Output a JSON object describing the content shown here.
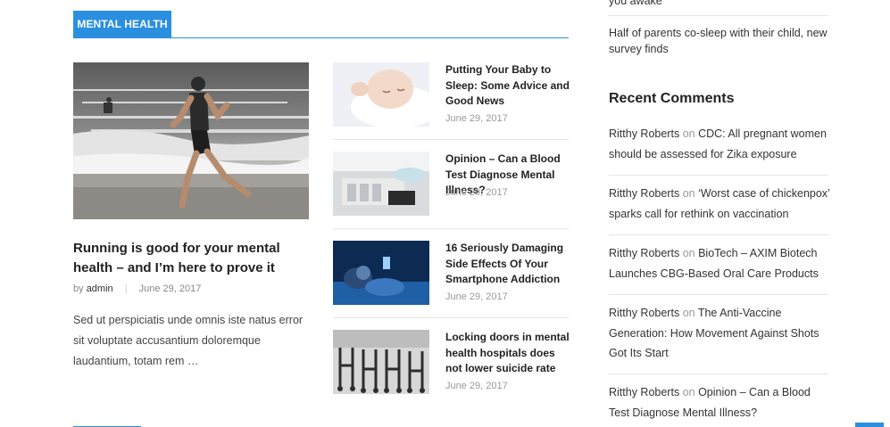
{
  "section": {
    "label": "MENTAL HEALTH"
  },
  "feature": {
    "title": "Running is good for your mental health – and I’m here to prove it",
    "by": "by",
    "author": "admin",
    "date": "June 29, 2017",
    "excerpt": "Sed ut perspiciatis unde omnis iste natus error sit voluptate accusantium doloremque laudantium, totam rem …"
  },
  "side_posts": [
    {
      "title": "Putting Your Baby to Sleep: Some Advice and Good News",
      "date": "June 29, 2017"
    },
    {
      "title": "Opinion – Can a Blood Test Diagnose Mental Illness?",
      "date": "June 29, 2017"
    },
    {
      "title": "16 Seriously Damaging Side Effects Of Your Smartphone Addiction",
      "date": "June 29, 2017"
    },
    {
      "title": "Locking doors in mental health hospitals does not lower suicide rate",
      "date": "June 29, 2017"
    }
  ],
  "sidebar": {
    "top_partial": "you awake",
    "recent_post": "Half of parents co-sleep with their child, new survey finds",
    "comments_heading": "Recent Comments",
    "comments": [
      {
        "author": "Ritthy Roberts",
        "on": "on",
        "post": "CDC: All pregnant women should be assessed for Zika exposure"
      },
      {
        "author": "Ritthy Roberts",
        "on": "on",
        "post": "‘Worst case of chickenpox’ sparks call for rethink on vaccination"
      },
      {
        "author": "Ritthy Roberts",
        "on": "on",
        "post": "BioTech – AXIM Biotech Launches CBG-Based Oral Care Products"
      },
      {
        "author": "Ritthy Roberts",
        "on": "on",
        "post": "The Anti-Vaccine Generation: How Movement Against Shots Got Its Start"
      },
      {
        "author": "Ritthy Roberts",
        "on": "on",
        "post": "Opinion – Can a Blood Test Diagnose Mental Illness?"
      }
    ]
  },
  "icons": {
    "scroll_top": "arrow-up-icon"
  },
  "colors": {
    "accent": "#2b8fe0"
  }
}
